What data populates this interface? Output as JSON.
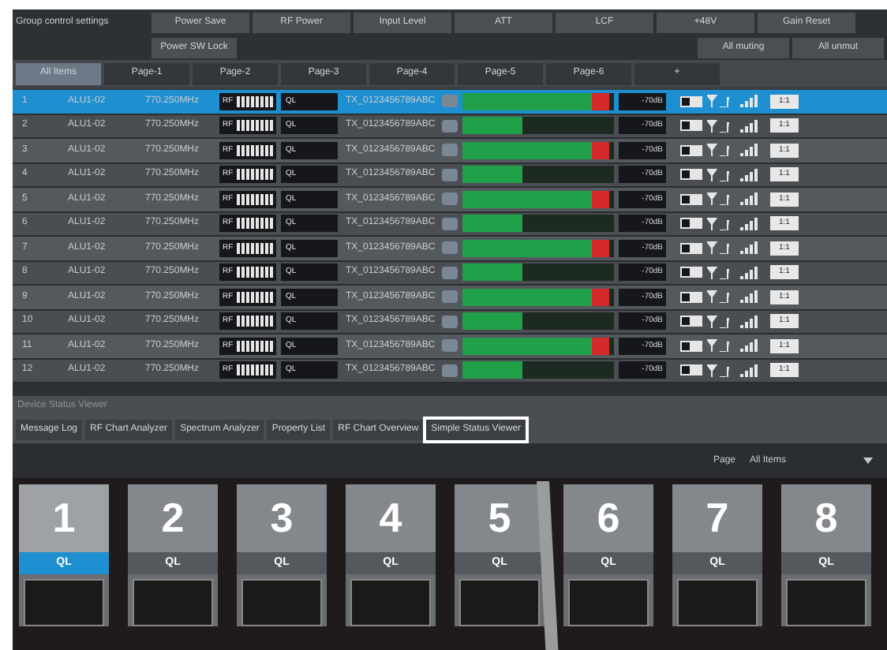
{
  "group_controls": {
    "label": "Group control settings",
    "buttons": [
      "Power Save",
      "RF Power",
      "Input Level",
      "ATT",
      "LCF",
      "+48V",
      "Gain Reset"
    ],
    "lock_button": "Power SW Lock",
    "right_buttons": [
      "All muting",
      "All unmut"
    ]
  },
  "pages": [
    {
      "label": "All Items",
      "selected": true
    },
    {
      "label": "Page-1",
      "selected": false
    },
    {
      "label": "Page-2",
      "selected": false
    },
    {
      "label": "Page-3",
      "selected": false
    },
    {
      "label": "Page-4",
      "selected": false
    },
    {
      "label": "Page-5",
      "selected": false
    },
    {
      "label": "Page-6",
      "selected": false
    },
    {
      "label": "+",
      "selected": false
    }
  ],
  "rows": [
    {
      "number": "1",
      "name": "ALU1-02",
      "frequency": "770.250MHz",
      "rf": "RF",
      "mode": "QL",
      "tx": "TX_0123456789ABC",
      "level": 0.97,
      "reading": "-70dB",
      "badge": "1:1",
      "selected": true
    },
    {
      "number": "2",
      "name": "ALU1-02",
      "frequency": "770.250MHz",
      "rf": "RF",
      "mode": "QL",
      "tx": "TX_0123456789ABC",
      "level": 0.4,
      "reading": "-70dB",
      "badge": "1:1",
      "selected": false
    },
    {
      "number": "3",
      "name": "ALU1-02",
      "frequency": "770.250MHz",
      "rf": "RF",
      "mode": "QL",
      "tx": "TX_0123456789ABC",
      "level": 0.97,
      "reading": "-70dB",
      "badge": "1:1",
      "selected": false
    },
    {
      "number": "4",
      "name": "ALU1-02",
      "frequency": "770.250MHz",
      "rf": "RF",
      "mode": "QL",
      "tx": "TX_0123456789ABC",
      "level": 0.4,
      "reading": "-70dB",
      "badge": "1:1",
      "selected": false
    },
    {
      "number": "5",
      "name": "ALU1-02",
      "frequency": "770.250MHz",
      "rf": "RF",
      "mode": "QL",
      "tx": "TX_0123456789ABC",
      "level": 0.97,
      "reading": "-70dB",
      "badge": "1:1",
      "selected": false
    },
    {
      "number": "6",
      "name": "ALU1-02",
      "frequency": "770.250MHz",
      "rf": "RF",
      "mode": "QL",
      "tx": "TX_0123456789ABC",
      "level": 0.4,
      "reading": "-70dB",
      "badge": "1:1",
      "selected": false
    },
    {
      "number": "7",
      "name": "ALU1-02",
      "frequency": "770.250MHz",
      "rf": "RF",
      "mode": "QL",
      "tx": "TX_0123456789ABC",
      "level": 0.97,
      "reading": "-70dB",
      "badge": "1:1",
      "selected": false
    },
    {
      "number": "8",
      "name": "ALU1-02",
      "frequency": "770.250MHz",
      "rf": "RF",
      "mode": "QL",
      "tx": "TX_0123456789ABC",
      "level": 0.4,
      "reading": "-70dB",
      "badge": "1:1",
      "selected": false
    },
    {
      "number": "9",
      "name": "ALU1-02",
      "frequency": "770.250MHz",
      "rf": "RF",
      "mode": "QL",
      "tx": "TX_0123456789ABC",
      "level": 0.97,
      "reading": "-70dB",
      "badge": "1:1",
      "selected": false
    },
    {
      "number": "10",
      "name": "ALU1-02",
      "frequency": "770.250MHz",
      "rf": "RF",
      "mode": "QL",
      "tx": "TX_0123456789ABC",
      "level": 0.4,
      "reading": "-70dB",
      "badge": "1:1",
      "selected": false
    },
    {
      "number": "11",
      "name": "ALU1-02",
      "frequency": "770.250MHz",
      "rf": "RF",
      "mode": "QL",
      "tx": "TX_0123456789ABC",
      "level": 0.97,
      "reading": "-70dB",
      "badge": "1:1",
      "selected": false
    },
    {
      "number": "12",
      "name": "ALU1-02",
      "frequency": "770.250MHz",
      "rf": "RF",
      "mode": "QL",
      "tx": "TX_0123456789ABC",
      "level": 0.4,
      "reading": "-70dB",
      "badge": "1:1",
      "selected": false
    }
  ],
  "panel": {
    "title": "Device Status Viewer",
    "tabs": [
      {
        "label": "Message Log",
        "selected": false
      },
      {
        "label": "RF Chart Analyzer",
        "selected": false
      },
      {
        "label": "Spectrum Analyzer",
        "selected": false
      },
      {
        "label": "Property List",
        "selected": false
      },
      {
        "label": "RF Chart Overview",
        "selected": false
      },
      {
        "label": "Simple Status Viewer",
        "selected": true
      }
    ],
    "page_label": "Page",
    "page_value": "All Items"
  },
  "channels": [
    {
      "number": "1",
      "mode": "QL",
      "selected": true
    },
    {
      "number": "2",
      "mode": "QL",
      "selected": false
    },
    {
      "number": "3",
      "mode": "QL",
      "selected": false
    },
    {
      "number": "4",
      "mode": "QL",
      "selected": false
    },
    {
      "number": "5",
      "mode": "QL",
      "selected": false
    },
    {
      "number": "6",
      "mode": "QL",
      "selected": false
    },
    {
      "number": "7",
      "mode": "QL",
      "selected": false
    },
    {
      "number": "8",
      "mode": "QL",
      "selected": false
    }
  ]
}
